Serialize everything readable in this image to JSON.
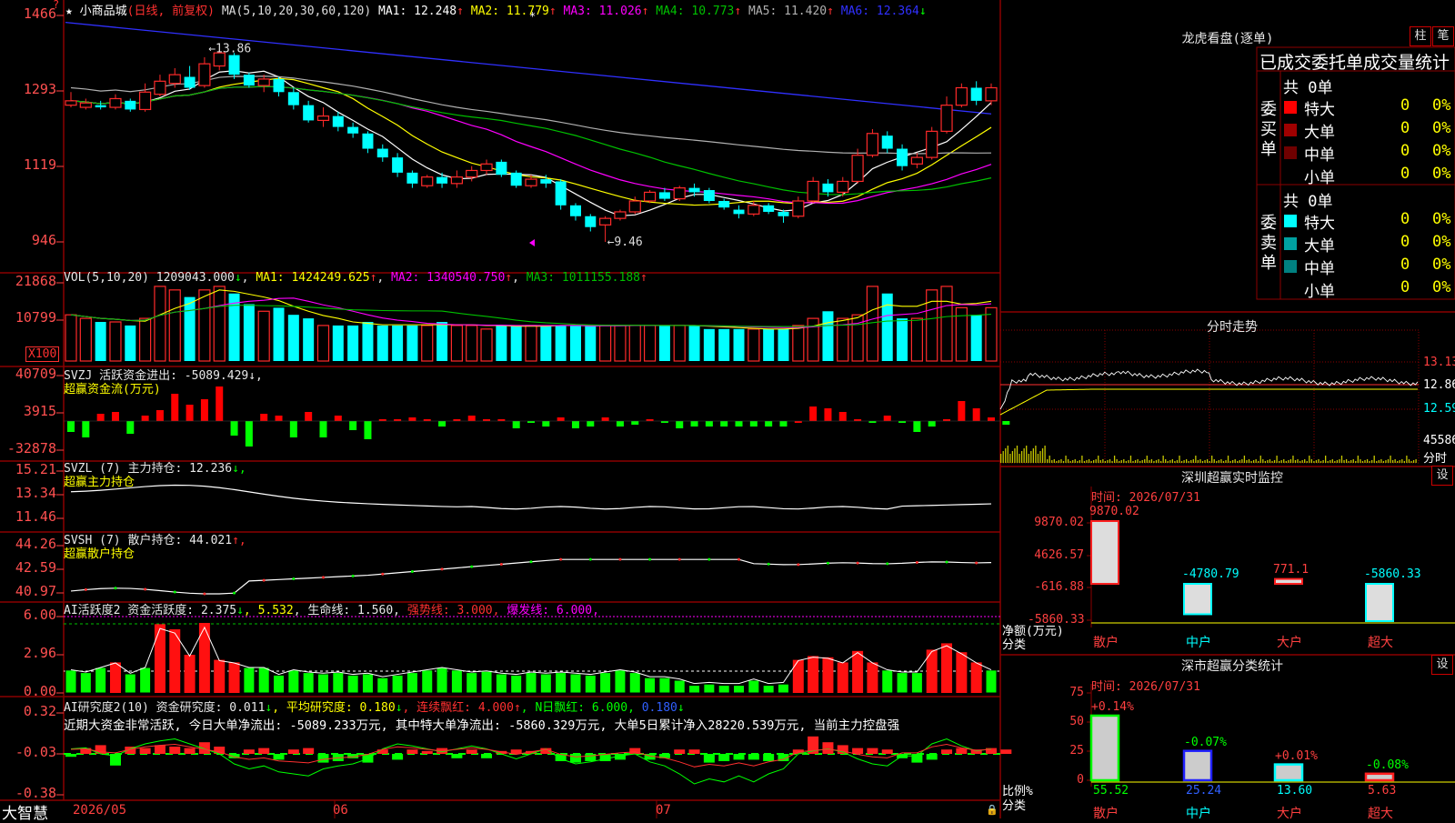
{
  "colors": {
    "up": "#ff2a2a",
    "down": "#00ffff",
    "ma1": "#ffffff",
    "ma2": "#ffff00",
    "ma3": "#ff00ff",
    "ma4": "#00c000",
    "ma5": "#b0b0b0",
    "ma6": "#3030ff",
    "grid": "#8b0000",
    "label_red": "#ff4040"
  },
  "main": {
    "star": "★",
    "stock_name": "小商品城",
    "period": "(日线, 前复权)",
    "ma_header": "MA(5,10,20,30,60,120)",
    "ma_items": [
      {
        "label": "MA1: 12.248",
        "arrow": "↑",
        "color": "#ffffff"
      },
      {
        "label": "MA2: 11.779",
        "arrow": "↑",
        "color": "#ffff00"
      },
      {
        "label": "MA3: 11.026",
        "arrow": "↑",
        "color": "#ff00ff"
      },
      {
        "label": "MA4: 10.773",
        "arrow": "↑",
        "color": "#00c000"
      },
      {
        "label": "MA5: 11.420",
        "arrow": "↑",
        "color": "#b0b0b0"
      },
      {
        "label": "MA6: 12.364",
        "arrow": "↓",
        "color": "#3030ff"
      }
    ],
    "y_ticks": [
      "1466",
      "1293",
      "1119",
      "946"
    ],
    "high_marker": "13.86",
    "low_marker": "9.46"
  },
  "vol": {
    "header": "VOL(5,10,20)",
    "value": "1209043.000",
    "value_arrow": "↓",
    "ma1": "MA1: 1424249.625",
    "ma1_arrow": "↑",
    "ma2": "MA2: 1340540.750",
    "ma2_arrow": "↑",
    "ma3": "MA3: 1011155.188",
    "ma3_arrow": "↑",
    "y_ticks": [
      "21868",
      "10799"
    ],
    "unit": "X100"
  },
  "svzj": {
    "header": "SVZJ  活跃资金进出: -5089.429",
    "tail": "↓,",
    "subtitle": "超赢资金流(万元)",
    "y_ticks": [
      "40709",
      "3915",
      "-32878"
    ]
  },
  "svzl": {
    "header": "SVZL (7) 主力持仓: 12.236",
    "tail": "↓,",
    "subtitle": "超赢主力持仓",
    "y_ticks": [
      "15.21",
      "13.34",
      "11.46"
    ]
  },
  "svsh": {
    "header": "SVSH (7) 散户持仓: 44.021",
    "tail": "↑,",
    "subtitle": "超赢散户持仓",
    "y_ticks": [
      "44.26",
      "42.59",
      "40.97"
    ]
  },
  "ai1": {
    "header": "AI活跃度2 资金活跃度: 2.375",
    "a1": "↓",
    "v2": ", 5.532",
    "v3": ", 生命线: 1.560,",
    "strong": "强势线: 3.000,",
    "burst": "爆发线: 6.000,",
    "y_ticks": [
      "6.00",
      "2.96",
      "0.00"
    ]
  },
  "ai2": {
    "header": "AI研究度2(10) 资金研究度: 0.011",
    "a1": "↓",
    "avg": ", 平均研究度: 0.180",
    "a2": "↓",
    "red": ", 连续飘红: 4.000",
    "a3": "↑",
    "nred": ", N日飘红: 6.000,",
    "last": " 0.180",
    "a4": "↓",
    "y_ticks": [
      "0.32",
      "-0.03",
      "-0.38"
    ],
    "comment": "近期大资金非常活跃, 今日大单净流出: -5089.233万元, 其中特大单净流出: -5860.329万元, 大单5日累计净入28220.539万元, 当前主力控盘强"
  },
  "footer": {
    "brand": "大智慧",
    "dates": [
      "2026/05",
      "06",
      "07"
    ]
  },
  "right": {
    "dragon_title": "龙虎看盘(逐单)",
    "btn_zhu": "柱",
    "btn_bi": "笔",
    "tabs": "已成交委托单成交量统计",
    "buy_label": "委买单",
    "sell_label": "委卖单",
    "buy_total": "共 0单",
    "sell_total": "共 0单",
    "buy_rows": [
      {
        "name": "特大",
        "n": "0",
        "p": "0%",
        "color": "#ff0000"
      },
      {
        "name": "大单",
        "n": "0",
        "p": "0%",
        "color": "#a00000"
      },
      {
        "name": "中单",
        "n": "0",
        "p": "0%",
        "color": "#700000"
      },
      {
        "name": "小单",
        "n": "0",
        "p": "0%",
        "color": ""
      }
    ],
    "sell_rows": [
      {
        "name": "特大",
        "n": "0",
        "p": "0%",
        "color": "#00ffff"
      },
      {
        "name": "大单",
        "n": "0",
        "p": "0%",
        "color": "#00a0a0"
      },
      {
        "name": "中单",
        "n": "0",
        "p": "0%",
        "color": "#008080"
      },
      {
        "name": "小单",
        "n": "0",
        "p": "0%",
        "color": ""
      }
    ],
    "intraday_title": "分时走势",
    "intraday_ticks": [
      "13.13",
      "12.86",
      "12.59",
      "45586",
      "分时"
    ],
    "sz_title": "深圳超赢实时监控",
    "sz_btn": "设",
    "sz_time": "时间: 2026/07/31",
    "sz_y": [
      "9870.02",
      "4626.57",
      "-616.88",
      "-5860.33"
    ],
    "sz_axis_label1": "净额(万元)",
    "sz_axis_label2": "分类",
    "sz_bars": [
      {
        "name": "散户",
        "val": "9870.02",
        "v": 9870.02
      },
      {
        "name": "中户",
        "val": "-4780.79",
        "v": -4780.79
      },
      {
        "name": "大户",
        "val": "771.1",
        "v": 771.1
      },
      {
        "name": "超大",
        "val": "-5860.33",
        "v": -5860.33
      }
    ],
    "ss_title": "深市超赢分类统计",
    "ss_btn": "设",
    "ss_time": "时间: 2026/07/31",
    "ss_y": [
      "75",
      "50",
      "25",
      "0"
    ],
    "ss_axis_label1": "比例%",
    "ss_axis_label2": "分类",
    "ss_bars": [
      {
        "name": "散户",
        "pct": "55.52",
        "chg": "+0.14%",
        "v": 55.52,
        "color": "#00ff00"
      },
      {
        "name": "中户",
        "pct": "25.24",
        "chg": "-0.07%",
        "v": 25.24,
        "color": "#2020ff"
      },
      {
        "name": "大户",
        "pct": "13.60",
        "chg": "+0.01%",
        "v": 13.6,
        "color": "#00ffff"
      },
      {
        "name": "超大",
        "pct": "5.63",
        "chg": "-0.08%",
        "v": 5.63,
        "color": "#ff2020"
      }
    ]
  },
  "chart_data": {
    "type": "candlestick",
    "title": "小商品城 (日线, 前复权)",
    "candles": [
      [
        12.6,
        12.7,
        12.55,
        12.9
      ],
      [
        12.55,
        12.65,
        12.5,
        12.75
      ],
      [
        12.6,
        12.55,
        12.5,
        12.7
      ],
      [
        12.55,
        12.75,
        12.5,
        12.85
      ],
      [
        12.7,
        12.5,
        12.45,
        12.75
      ],
      [
        12.5,
        12.9,
        12.45,
        13.1
      ],
      [
        12.85,
        13.15,
        12.8,
        13.3
      ],
      [
        13.1,
        13.3,
        13.0,
        13.45
      ],
      [
        13.25,
        13.0,
        12.95,
        13.5
      ],
      [
        13.05,
        13.55,
        13.0,
        13.7
      ],
      [
        13.5,
        13.8,
        13.4,
        13.86
      ],
      [
        13.75,
        13.3,
        13.2,
        13.8
      ],
      [
        13.3,
        13.05,
        13.0,
        13.35
      ],
      [
        13.05,
        13.2,
        12.9,
        13.3
      ],
      [
        13.2,
        12.9,
        12.8,
        13.25
      ],
      [
        12.9,
        12.6,
        12.5,
        13.0
      ],
      [
        12.6,
        12.25,
        12.2,
        12.7
      ],
      [
        12.25,
        12.35,
        12.1,
        12.55
      ],
      [
        12.35,
        12.1,
        12.0,
        12.45
      ],
      [
        12.1,
        11.95,
        11.85,
        12.2
      ],
      [
        11.95,
        11.6,
        11.5,
        12.0
      ],
      [
        11.6,
        11.4,
        11.3,
        11.7
      ],
      [
        11.4,
        11.05,
        10.95,
        11.5
      ],
      [
        11.05,
        10.8,
        10.7,
        11.1
      ],
      [
        10.75,
        10.95,
        10.7,
        11.0
      ],
      [
        10.95,
        10.8,
        10.7,
        11.05
      ],
      [
        10.8,
        10.95,
        10.7,
        11.1
      ],
      [
        10.95,
        11.1,
        10.85,
        11.2
      ],
      [
        11.1,
        11.25,
        11.0,
        11.35
      ],
      [
        11.3,
        11.0,
        10.95,
        11.35
      ],
      [
        11.05,
        10.75,
        10.7,
        11.1
      ],
      [
        10.75,
        10.9,
        10.7,
        11.0
      ],
      [
        10.9,
        10.8,
        10.7,
        11.0
      ],
      [
        10.85,
        10.3,
        10.2,
        10.9
      ],
      [
        10.3,
        10.05,
        9.95,
        10.35
      ],
      [
        10.05,
        9.8,
        9.7,
        10.1
      ],
      [
        9.85,
        10.0,
        9.46,
        10.05
      ],
      [
        10.0,
        10.15,
        9.95,
        10.2
      ],
      [
        10.15,
        10.4,
        10.1,
        10.5
      ],
      [
        10.4,
        10.6,
        10.35,
        10.65
      ],
      [
        10.6,
        10.45,
        10.4,
        10.7
      ],
      [
        10.45,
        10.7,
        10.4,
        10.75
      ],
      [
        10.7,
        10.6,
        10.5,
        10.8
      ],
      [
        10.65,
        10.4,
        10.35,
        10.7
      ],
      [
        10.4,
        10.25,
        10.2,
        10.45
      ],
      [
        10.2,
        10.1,
        10.0,
        10.3
      ],
      [
        10.1,
        10.3,
        10.05,
        10.4
      ],
      [
        10.3,
        10.15,
        10.1,
        10.35
      ],
      [
        10.15,
        10.05,
        9.9,
        10.2
      ],
      [
        10.05,
        10.4,
        10.0,
        10.5
      ],
      [
        10.4,
        10.85,
        10.35,
        10.95
      ],
      [
        10.8,
        10.6,
        10.5,
        10.9
      ],
      [
        10.6,
        10.85,
        10.5,
        10.95
      ],
      [
        10.85,
        11.45,
        10.8,
        11.6
      ],
      [
        11.45,
        11.95,
        11.4,
        12.05
      ],
      [
        11.9,
        11.6,
        11.5,
        12.0
      ],
      [
        11.6,
        11.2,
        11.1,
        11.7
      ],
      [
        11.25,
        11.4,
        11.15,
        11.5
      ],
      [
        11.4,
        12.0,
        11.35,
        12.1
      ],
      [
        12.0,
        12.6,
        11.95,
        12.8
      ],
      [
        12.6,
        13.0,
        12.55,
        13.1
      ],
      [
        13.0,
        12.7,
        12.6,
        13.15
      ],
      [
        12.7,
        13.0,
        12.6,
        13.1
      ]
    ],
    "y_range": [
      9.46,
      13.86
    ],
    "series": [
      {
        "name": "MA1"
      },
      {
        "name": "MA2"
      },
      {
        "name": "MA3"
      },
      {
        "name": "MA4"
      },
      {
        "name": "MA5"
      },
      {
        "name": "MA6"
      }
    ]
  }
}
